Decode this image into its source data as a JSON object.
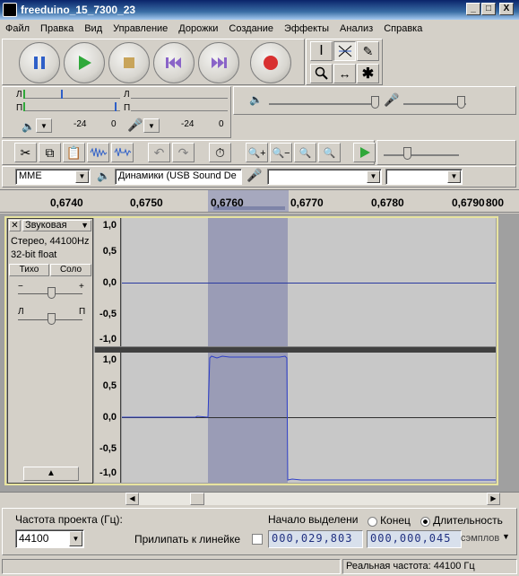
{
  "window": {
    "title": "freeduino_15_7300_23",
    "min": "_",
    "max": "□",
    "close": "X"
  },
  "menu": [
    "Файл",
    "Правка",
    "Вид",
    "Управление",
    "Дорожки",
    "Создание",
    "Эффекты",
    "Анализ",
    "Справка"
  ],
  "meters": {
    "left": "Л",
    "right": "П",
    "db1": "-24",
    "db2": "0",
    "db3": "-24",
    "db4": "0"
  },
  "device": {
    "host": "MME",
    "output": "Динамики (USB Sound De",
    "input": "",
    "channels": ""
  },
  "ruler": {
    "ticks": [
      "0,6740",
      "0,6750",
      "0,6760",
      "0,6770",
      "0,6780",
      "0,6790",
      "800"
    ]
  },
  "track": {
    "name": "Звуковая",
    "info1": "Стерео, 44100Hz",
    "info2": "32-bit float",
    "mute": "Тихо",
    "solo": "Соло",
    "gain_minus": "−",
    "gain_plus": "+",
    "pan_l": "Л",
    "pan_r": "П",
    "collapse": "▲"
  },
  "vscale": {
    "ch1": [
      "1,0",
      "0,5",
      "0,0",
      "-0,5",
      "-1,0"
    ],
    "ch2": [
      "1,0",
      "0,5",
      "0,0",
      "-0,5",
      "-1,0"
    ]
  },
  "selbar": {
    "rate_label": "Частота проекта (Гц):",
    "rate_value": "44100",
    "snap_label": "Прилипать к линейке",
    "sel_start_label": "Начало выделени",
    "end_label": "Конец",
    "length_label": "Длительность",
    "sel_start": "000,029,803",
    "sel_length": "000,000,045",
    "units": "сэмплов"
  },
  "status": {
    "rate": "Реальная частота: 44100 Гц"
  }
}
